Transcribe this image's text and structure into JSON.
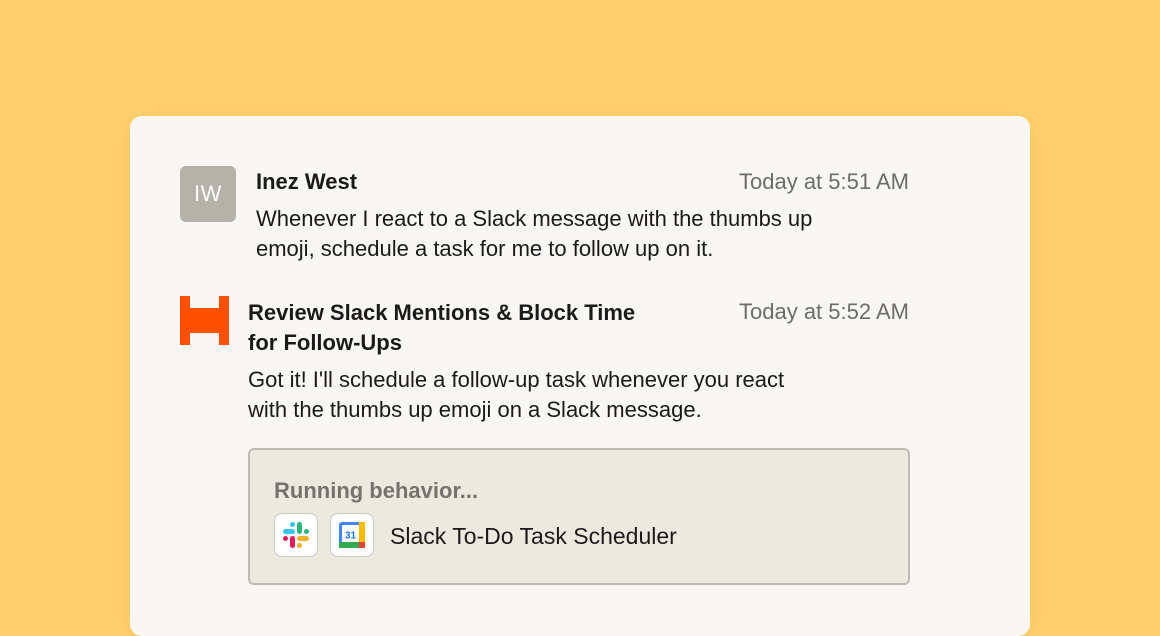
{
  "user_message": {
    "avatar_initials": "IW",
    "name": "Inez West",
    "time": "Today at 5:51 AM",
    "text_line1": "Whenever I react to a Slack message with the thumbs up",
    "text_line2": "emoji, schedule a task for me to follow up on it."
  },
  "bot_message": {
    "logo_icon": "zapier-agent-icon",
    "title_line1": "Review Slack Mentions & Block Time",
    "title_line2": "for Follow-Ups",
    "time": "Today at 5:52 AM",
    "text_line1": "Got it! I'll schedule a follow-up task whenever you react",
    "text_line2": "with the thumbs up emoji on a Slack message."
  },
  "running_behavior": {
    "label": "Running behavior...",
    "app_icons": [
      "slack-icon",
      "google-calendar-icon"
    ],
    "calendar_day": "31",
    "behavior_name": "Slack To-Do Task Scheduler"
  },
  "colors": {
    "background": "#FFD16E",
    "card": "#F8F7F3",
    "brand_orange": "#FF4F00",
    "avatar": "#B4B2A9"
  }
}
